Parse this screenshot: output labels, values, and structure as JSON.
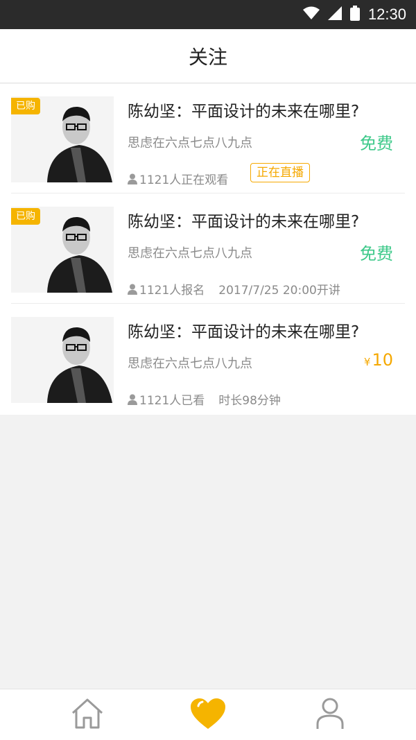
{
  "status_bar": {
    "time": "12:30",
    "icons": [
      "wifi-icon",
      "signal-icon",
      "battery-icon"
    ]
  },
  "header": {
    "title": "关注"
  },
  "colors": {
    "accent": "#f5b400",
    "free_green": "#3ec98a",
    "price_orange": "#f5a800",
    "text_dark": "#222222",
    "text_gray": "#8a8a8a"
  },
  "courses": [
    {
      "badge": "已购",
      "title": "陈幼坚：平面设计的未来在哪里?",
      "subtitle": "思虑在六点七点八九点",
      "price": "免费",
      "stat": "1121人正在观看",
      "extra": "",
      "live_tag": "正在直播"
    },
    {
      "badge": "已购",
      "title": "陈幼坚：平面设计的未来在哪里?",
      "subtitle": "思虑在六点七点八九点",
      "price": "免费",
      "stat": "1121人报名",
      "extra": "2017/7/25  20:00开讲",
      "live_tag": ""
    },
    {
      "badge": "",
      "title": "陈幼坚：平面设计的未来在哪里?",
      "subtitle": "思虑在六点七点八九点",
      "price_currency": "¥",
      "price": "10",
      "stat": "1121人已看",
      "extra": "时长98分钟",
      "live_tag": ""
    }
  ],
  "tabbar": {
    "tabs": [
      {
        "icon": "home-icon",
        "active": false
      },
      {
        "icon": "heart-icon",
        "active": true
      },
      {
        "icon": "user-icon",
        "active": false
      }
    ]
  }
}
